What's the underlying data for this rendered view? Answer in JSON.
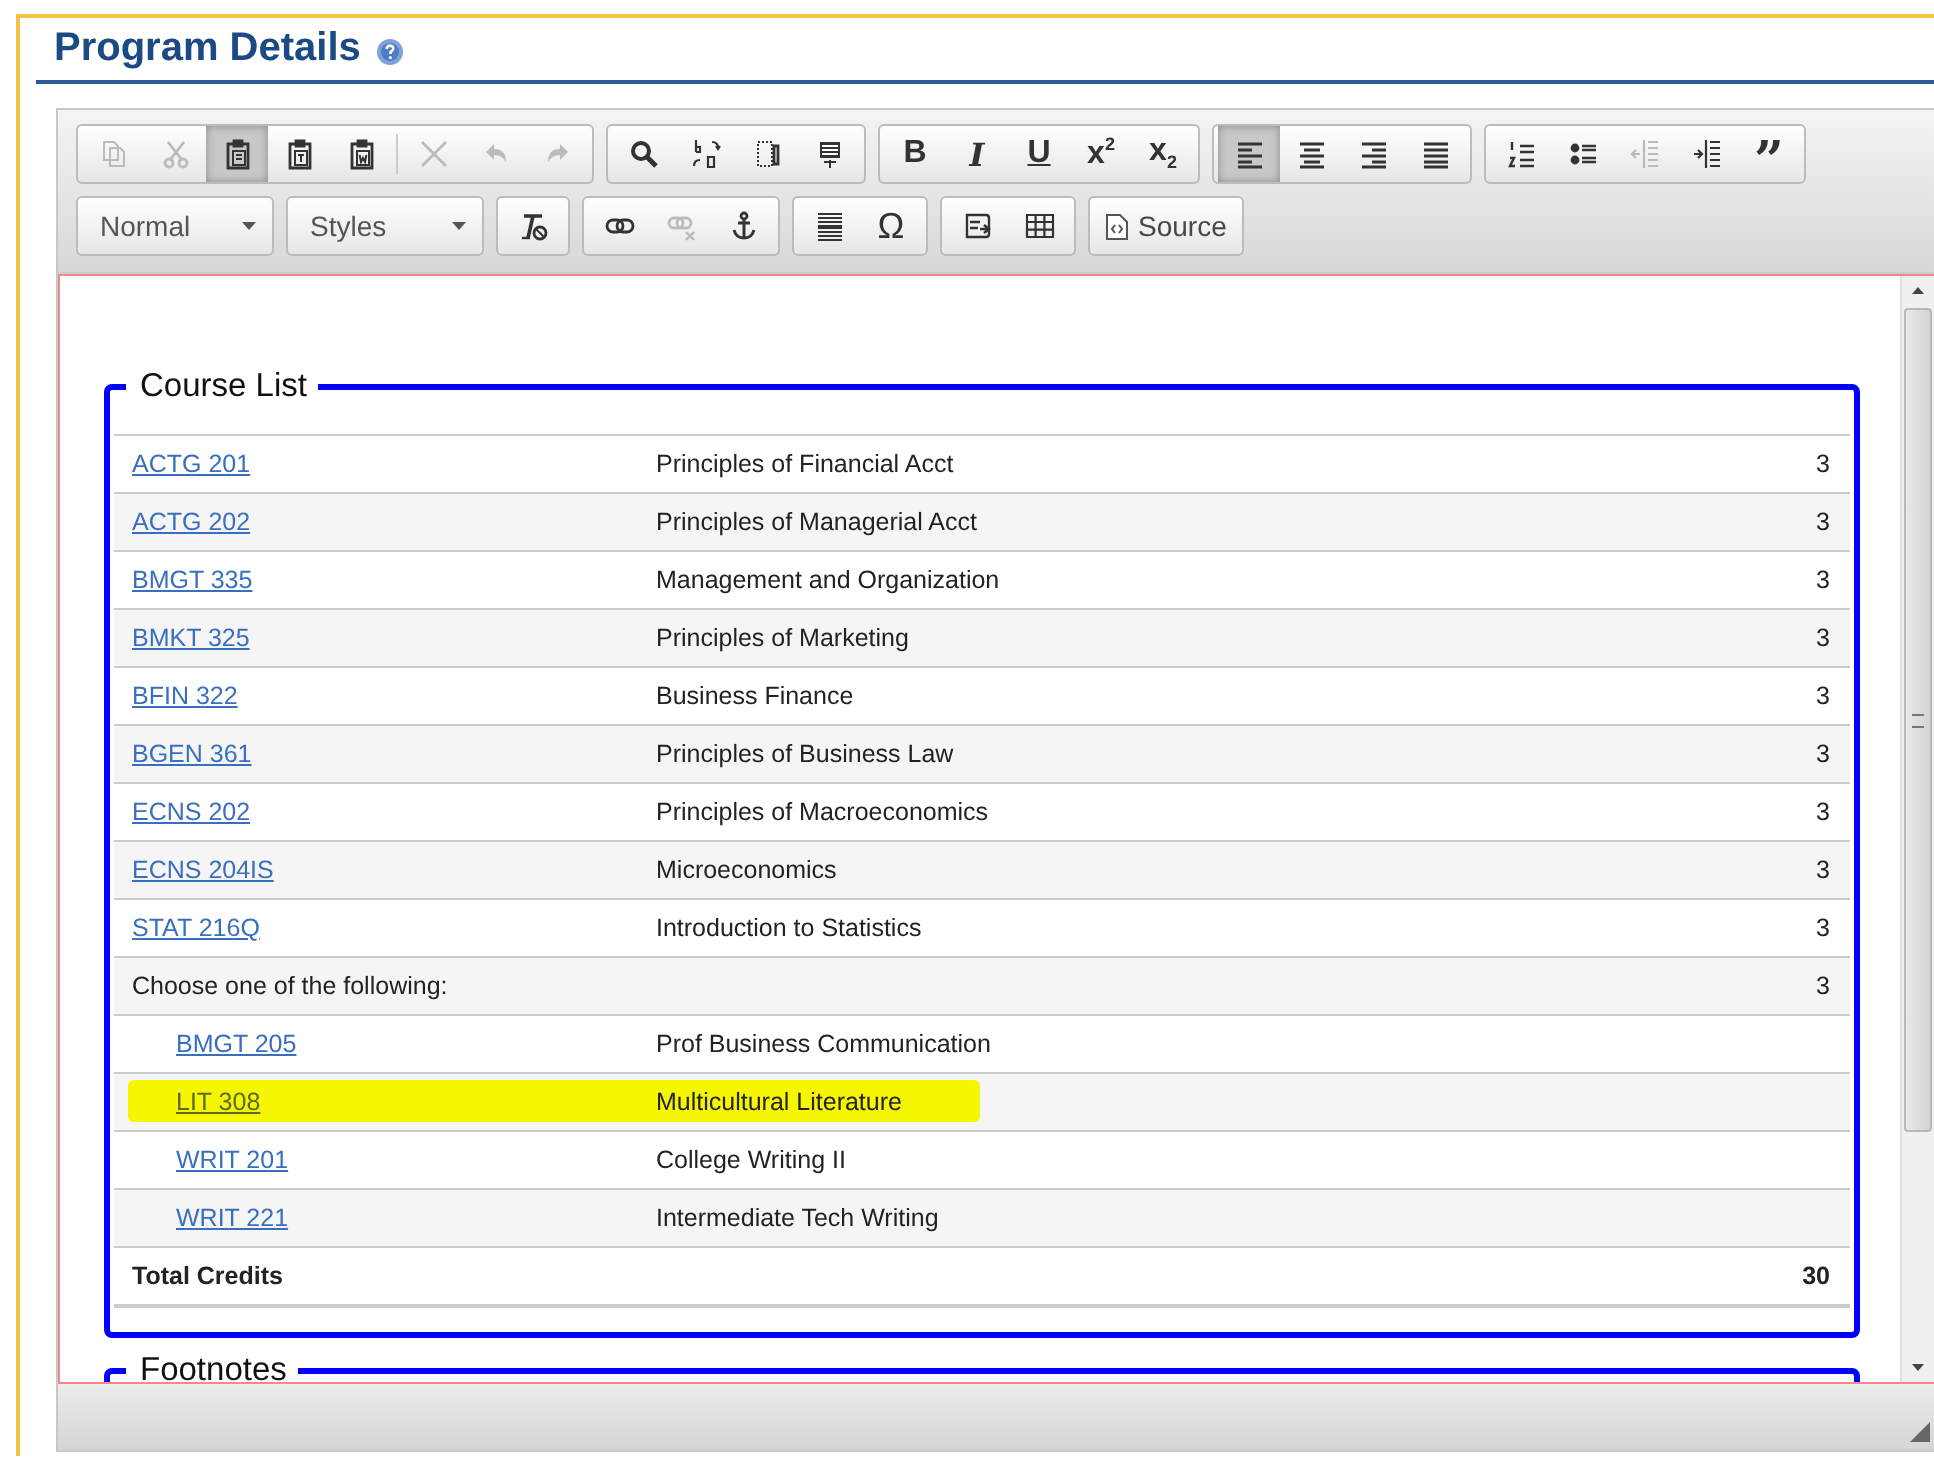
{
  "page": {
    "title": "Program Details"
  },
  "toolbar": {
    "rows": [
      [
        {
          "buttons": [
            {
              "kind": "copy",
              "disabled": true,
              "selected": false
            },
            {
              "kind": "cut",
              "disabled": true,
              "selected": false
            },
            {
              "kind": "paste",
              "disabled": false,
              "selected": true
            },
            {
              "kind": "paste-text",
              "disabled": false,
              "selected": false
            },
            {
              "kind": "paste-word",
              "disabled": false,
              "selected": false
            },
            {
              "kind": "separator"
            },
            {
              "kind": "delete",
              "disabled": true,
              "selected": false
            },
            {
              "kind": "undo",
              "disabled": true,
              "selected": false
            },
            {
              "kind": "redo",
              "disabled": true,
              "selected": false
            }
          ]
        },
        {
          "buttons": [
            {
              "kind": "find",
              "disabled": false,
              "selected": false
            },
            {
              "kind": "replace",
              "disabled": false,
              "selected": false
            },
            {
              "kind": "select-all",
              "disabled": false,
              "selected": false
            },
            {
              "kind": "show-blocks",
              "disabled": false,
              "selected": false
            }
          ]
        },
        {
          "buttons": [
            {
              "kind": "bold",
              "label": "B",
              "disabled": false,
              "selected": false
            },
            {
              "kind": "italic",
              "label": "I",
              "disabled": false,
              "selected": false
            },
            {
              "kind": "underline",
              "label": "U",
              "disabled": false,
              "selected": false
            },
            {
              "kind": "superscript",
              "label": "x$^{2}$",
              "disabled": false,
              "selected": false
            },
            {
              "kind": "subscript",
              "label": "x$_{2}$",
              "disabled": false,
              "selected": false
            }
          ]
        },
        {
          "buttons": [
            {
              "kind": "align-left",
              "disabled": false,
              "selected": true
            },
            {
              "kind": "align-center",
              "disabled": false,
              "selected": false
            },
            {
              "kind": "align-right",
              "disabled": false,
              "selected": false
            },
            {
              "kind": "justify",
              "disabled": false,
              "selected": false
            }
          ]
        },
        {
          "buttons": [
            {
              "kind": "numbered-list",
              "disabled": false,
              "selected": false
            },
            {
              "kind": "bulleted-list",
              "disabled": false,
              "selected": false
            },
            {
              "kind": "outdent",
              "disabled": true,
              "selected": false
            },
            {
              "kind": "indent",
              "disabled": false,
              "selected": false
            },
            {
              "kind": "blockquote",
              "label": "”",
              "disabled": false,
              "selected": false
            }
          ]
        }
      ],
      [
        {
          "kind": "dropdown",
          "value": "Normal"
        },
        {
          "kind": "dropdown",
          "value": "Styles"
        },
        {
          "buttons": [
            {
              "kind": "remove-format",
              "disabled": false,
              "selected": false
            }
          ]
        },
        {
          "buttons": [
            {
              "kind": "link",
              "disabled": false,
              "selected": false
            },
            {
              "kind": "unlink",
              "disabled": true,
              "selected": false
            },
            {
              "kind": "anchor",
              "disabled": false,
              "selected": false
            }
          ]
        },
        {
          "buttons": [
            {
              "kind": "horizontal-rule",
              "disabled": false,
              "selected": false
            },
            {
              "kind": "special-char",
              "label": "Ω",
              "disabled": false,
              "selected": false
            }
          ]
        },
        {
          "buttons": [
            {
              "kind": "iframe",
              "disabled": false,
              "selected": false
            },
            {
              "kind": "table",
              "disabled": false,
              "selected": false
            }
          ]
        },
        {
          "buttons": [
            {
              "kind": "source",
              "label": "Source",
              "disabled": false,
              "selected": false
            }
          ]
        }
      ]
    ]
  },
  "course_list": {
    "legend": "Course List",
    "rows": [
      {
        "kind": "course",
        "code": "ACTG 201",
        "title": "Principles of Financial Acct",
        "credits": "3",
        "highlighted": false
      },
      {
        "kind": "course",
        "code": "ACTG 202",
        "title": "Principles of Managerial Acct",
        "credits": "3",
        "highlighted": false
      },
      {
        "kind": "course",
        "code": "BMGT 335",
        "title": "Management and Organization",
        "credits": "3",
        "highlighted": false
      },
      {
        "kind": "course",
        "code": "BMKT 325",
        "title": "Principles of Marketing",
        "credits": "3",
        "highlighted": false
      },
      {
        "kind": "course",
        "code": "BFIN 322",
        "title": "Business Finance",
        "credits": "3",
        "highlighted": false
      },
      {
        "kind": "course",
        "code": "BGEN 361",
        "title": "Principles of Business Law",
        "credits": "3",
        "highlighted": false
      },
      {
        "kind": "course",
        "code": "ECNS 202",
        "title": "Principles of Macroeconomics",
        "credits": "3",
        "highlighted": false
      },
      {
        "kind": "course",
        "code": "ECNS 204IS",
        "title": "Microeconomics",
        "credits": "3",
        "highlighted": false
      },
      {
        "kind": "course",
        "code": "STAT 216Q",
        "title": "Introduction to Statistics",
        "credits": "3",
        "highlighted": false
      },
      {
        "kind": "heading",
        "text": "Choose one of the following:",
        "credits": "3",
        "highlighted": false
      },
      {
        "kind": "option",
        "code": "BMGT 205",
        "title": "Prof Business Communication",
        "highlighted": false
      },
      {
        "kind": "option",
        "code": "LIT 308",
        "title": "Multicultural Literature",
        "highlighted": true
      },
      {
        "kind": "option",
        "code": "WRIT 201",
        "title": "College Writing II",
        "highlighted": false
      },
      {
        "kind": "option",
        "code": "WRIT 221",
        "title": "Intermediate Tech Writing",
        "highlighted": false
      },
      {
        "kind": "total",
        "text": "Total Credits",
        "credits": "30",
        "highlighted": false
      }
    ]
  },
  "footnotes": {
    "legend": "Footnotes"
  }
}
